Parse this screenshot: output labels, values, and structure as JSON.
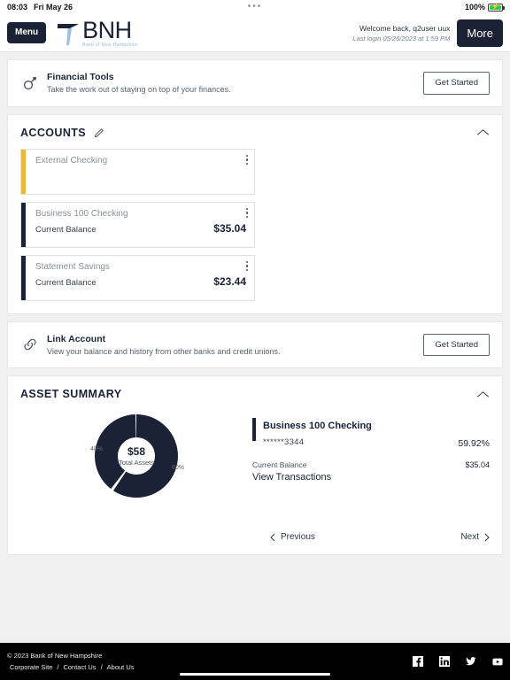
{
  "statusbar": {
    "time": "08:03",
    "date": "Fri May 26",
    "center_dots": "•••",
    "battery_percent": "100%",
    "battery_icon": "battery-charging-icon"
  },
  "header": {
    "menu_label": "Menu",
    "logo_name": "BNH",
    "logo_tagline": "Bank of New Hampshire",
    "welcome": "Welcome back, q2user uux",
    "last_login": "Last login 05/26/2023 at 1:59 PM",
    "more_label": "More"
  },
  "financial_tools": {
    "icon": "financial-tools-icon",
    "title": "Financial Tools",
    "subtitle": "Take the work out of staying on top of your finances.",
    "cta": "Get Started"
  },
  "accounts": {
    "title": "ACCOUNTS",
    "edit_icon": "pencil-icon",
    "collapse_icon": "chevron-up-icon",
    "tiles": [
      {
        "name": "External Checking",
        "balance_label": "",
        "balance": "",
        "accent": "#e8b93c",
        "menu_icon": "kebab-menu-icon"
      },
      {
        "name": "Business 100 Checking",
        "balance_label": "Current Balance",
        "balance": "$35.04",
        "accent": "#1b2236",
        "menu_icon": "kebab-menu-icon"
      },
      {
        "name": "Statement Savings",
        "balance_label": "Current Balance",
        "balance": "$23.44",
        "accent": "#1b2236",
        "menu_icon": "kebab-menu-icon"
      }
    ]
  },
  "link_account": {
    "icon": "link-icon",
    "title": "Link Account",
    "subtitle": "View your balance and history from other banks and credit unions.",
    "cta": "Get Started"
  },
  "asset_summary": {
    "title": "ASSET SUMMARY",
    "collapse_icon": "chevron-up-icon",
    "total_amount": "$58",
    "total_caption": "Total Assets",
    "slice_label_left": "40%",
    "slice_label_right": "60%",
    "detail": {
      "account_name": "Business 100 Checking",
      "account_mask": "******3344",
      "percent": "59.92%",
      "balance_label": "Current Balance",
      "balance": "$35.04",
      "view_transactions": "View Transactions"
    },
    "pager": {
      "previous": "Previous",
      "next": "Next",
      "prev_icon": "chevron-left-icon",
      "next_icon": "chevron-right-icon"
    }
  },
  "footer": {
    "copyright": "© 2023 Bank of New Hampshire",
    "links": [
      "Corporate Site",
      "Contact Us",
      "About Us"
    ],
    "separator": "/",
    "social": [
      "facebook-icon",
      "linkedin-icon",
      "twitter-icon",
      "youtube-icon"
    ]
  },
  "chart_data": {
    "type": "pie",
    "title": "Asset Summary",
    "categories": [
      "Business 100 Checking",
      "Statement Savings"
    ],
    "values": [
      59.92,
      40.08
    ],
    "display_labels": [
      "60%",
      "40%"
    ],
    "center_value": "$58",
    "center_label": "Total Assets",
    "colors": [
      "#1b2236",
      "#1b2236"
    ],
    "legend": "right"
  }
}
